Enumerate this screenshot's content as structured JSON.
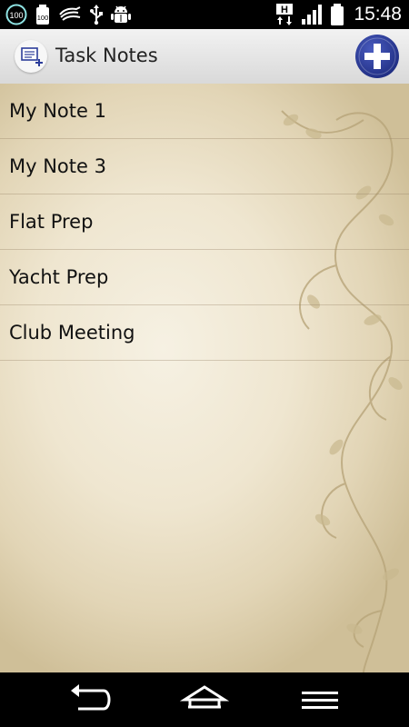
{
  "status_bar": {
    "icons_left": [
      "battery-100-icon",
      "battery-100-alt-icon",
      "sync-icon",
      "usb-icon",
      "android-debug-icon"
    ],
    "badge_100a": "100",
    "badge_100b": "100",
    "network_badge": "H",
    "time": "15:48"
  },
  "action_bar": {
    "title": "Task Notes",
    "add_icon": "plus-circle-icon",
    "accent": "#2b3c9a"
  },
  "notes": [
    {
      "label": "My Note 1"
    },
    {
      "label": "My Note 3"
    },
    {
      "label": "Flat Prep"
    },
    {
      "label": "Yacht Prep"
    },
    {
      "label": "Club Meeting"
    }
  ],
  "nav_bar": {
    "back_icon": "back-arrow-icon",
    "home_icon": "home-icon",
    "menu_icon": "menu-icon"
  }
}
